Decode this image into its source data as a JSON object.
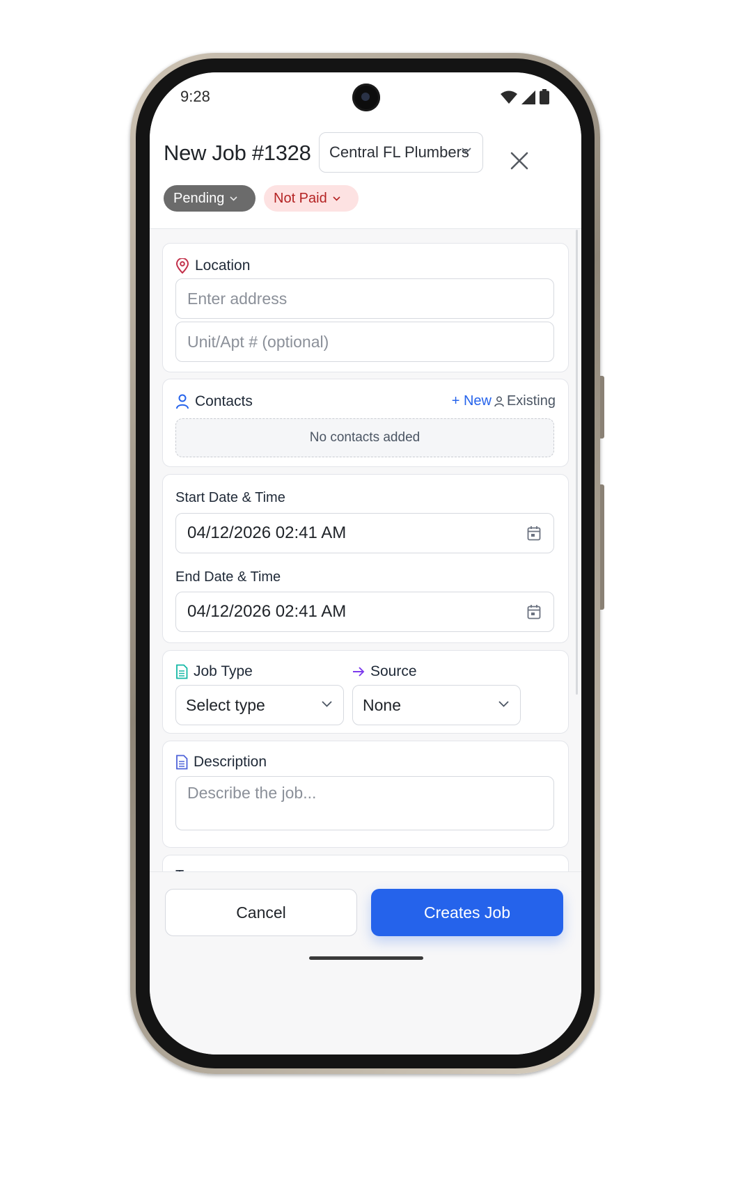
{
  "status_bar": {
    "time": "9:28"
  },
  "header": {
    "title": "New Job #1328",
    "company": "Central FL Plumbers",
    "status_pill": "Pending",
    "payment_pill": "Not Paid"
  },
  "location": {
    "label": "Location",
    "address_placeholder": "Enter address",
    "unit_placeholder": "Unit/Apt # (optional)"
  },
  "contacts": {
    "label": "Contacts",
    "new_label": "+ New",
    "existing_label": "Existing",
    "empty_text": "No contacts added"
  },
  "schedule": {
    "start_label": "Start Date & Time",
    "start_value": "04/12/2026 02:41 AM",
    "end_label": "End Date & Time",
    "end_value": "04/12/2026 02:41 AM"
  },
  "job_type": {
    "label": "Job Type",
    "value": "Select type"
  },
  "source": {
    "label": "Source",
    "value": "None"
  },
  "description": {
    "label": "Description",
    "placeholder": "Describe the job..."
  },
  "tags": {
    "label": "Tags"
  },
  "footer": {
    "cancel_label": "Cancel",
    "create_label": "Creates Job"
  },
  "colors": {
    "accent": "#2563eb",
    "pending": "#6b6b6b",
    "not_paid_bg": "#fde2e2",
    "not_paid_text": "#b42323"
  }
}
